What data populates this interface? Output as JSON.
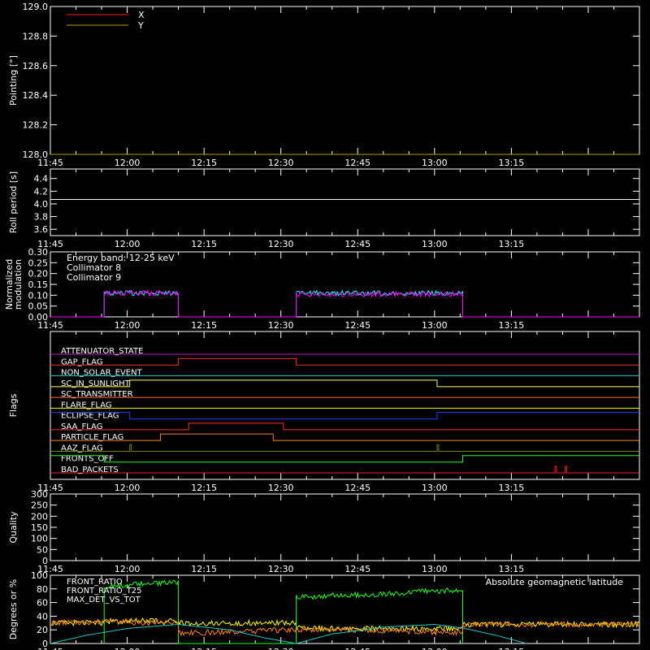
{
  "chart_data": [
    {
      "type": "line",
      "ylabel": "Pointing [°]",
      "ylim": [
        128.0,
        129.0
      ],
      "yticks": [
        "129.0",
        "128.8",
        "128.6",
        "128.4",
        "128.2",
        "128.0"
      ],
      "xlim": [
        -15,
        100
      ],
      "legend": "top-left",
      "series": [
        {
          "name": "X",
          "color": "#ff2020",
          "x": [
            -15,
            100
          ],
          "y": [
            128.0,
            128.0
          ]
        },
        {
          "name": "Y",
          "color": "#b4a000",
          "x": [
            -15,
            100
          ],
          "y": [
            128.0,
            128.0
          ]
        }
      ]
    },
    {
      "type": "line",
      "ylabel": "Roll period [s]",
      "ylim": [
        3.5,
        4.55
      ],
      "yticks": [
        "4.4",
        "4.2",
        "4.0",
        "3.8",
        "3.6"
      ],
      "xlim": [
        -15,
        100
      ],
      "series": [
        {
          "color": "#ffffff",
          "x": [
            -15,
            100
          ],
          "y": [
            4.07,
            4.07
          ]
        }
      ]
    },
    {
      "type": "line",
      "ylabel": "Normalized modulation",
      "ylim": [
        0.0,
        0.3
      ],
      "yticks": [
        "0.30",
        "0.25",
        "0.20",
        "0.15",
        "0.10",
        "0.05",
        "0.00"
      ],
      "xlim": [
        -15,
        100
      ],
      "annotation": "Energy band: 12-25 keV",
      "legend": "top-left",
      "series": [
        {
          "name": "Collimator 8",
          "color": "#00ffff",
          "x": [
            -15,
            -4.5,
            -4.5,
            10,
            10,
            33,
            33,
            65.5,
            65.5,
            100
          ],
          "y": [
            0,
            0,
            0.11,
            0.11,
            0,
            0,
            0.11,
            0.11,
            0,
            0
          ]
        },
        {
          "name": "Collimator 9",
          "color": "#ff00ff",
          "x": [
            -15,
            -4.5,
            -4.5,
            10,
            10,
            33,
            33,
            65.5,
            65.5,
            100
          ],
          "y": [
            0,
            0,
            0.11,
            0.11,
            0,
            0,
            0.105,
            0.105,
            0,
            0
          ]
        }
      ]
    },
    {
      "type": "line",
      "ylabel": "Flags",
      "xlim": [
        -15,
        100
      ],
      "flags": [
        {
          "name": "ATTENUATOR_STATE",
          "color": "#c020c0",
          "transitions": [],
          "start": 0
        },
        {
          "name": "GAP_FLAG",
          "color": "#ff3020",
          "transitions": [
            10,
            33
          ],
          "start": 0
        },
        {
          "name": "NON_SOLAR_EVENT",
          "color": "#00c8c8",
          "transitions": [],
          "start": 0
        },
        {
          "name": "SC_IN_SUNLIGHT",
          "color": "#ffff40",
          "transitions": [
            0.5,
            60.5
          ],
          "start": 0
        },
        {
          "name": "SC_TRANSMITTER",
          "color": "#ff7030",
          "transitions": [],
          "start": 0
        },
        {
          "name": "FLARE_FLAG",
          "color": "#ffff00",
          "transitions": [],
          "start": 0
        },
        {
          "name": "ECLIPSE_FLAG",
          "color": "#2040ff",
          "transitions": [
            0.5,
            60.5
          ],
          "start": 1
        },
        {
          "name": "SAA_FLAG",
          "color": "#ff3030",
          "transitions": [
            12,
            30.5
          ],
          "start": 0
        },
        {
          "name": "PARTICLE_FLAG",
          "color": "#ff8020",
          "transitions": [
            6.5,
            28.5
          ],
          "start": 0
        },
        {
          "name": "AAZ_FLAG",
          "color": "#808000",
          "pulses": [
            0.5,
            60.5
          ]
        },
        {
          "name": "FRONTS_OFF",
          "color": "#20ff20",
          "transitions": [
            -4.5,
            65.5
          ],
          "start": 1
        },
        {
          "name": "BAD_PACKETS",
          "color": "#ff2020",
          "pulses": [
            83.5,
            85.5
          ]
        }
      ]
    },
    {
      "type": "line",
      "ylabel": "Quality",
      "ylim": [
        0,
        300
      ],
      "yticks": [
        "300",
        "250",
        "200",
        "150",
        "100",
        "50",
        "0"
      ],
      "xlim": [
        -15,
        100
      ],
      "series": []
    },
    {
      "type": "line",
      "ylabel": "Degrees or %",
      "ylim": [
        0,
        100
      ],
      "yticks": [
        "100",
        "80",
        "60",
        "40",
        "20",
        "0"
      ],
      "xlim": [
        -15,
        100
      ],
      "legend": "top-left",
      "annotation": "Absolute geomagnetic latitude",
      "series": [
        {
          "name": "FRONT_RATIO",
          "color": "#ffff00",
          "x": [
            -15,
            -4.5,
            -4.5,
            10,
            10,
            33,
            33,
            65.5,
            65.5,
            100
          ],
          "y": [
            30,
            30,
            33,
            33,
            30,
            30,
            22,
            22,
            28,
            28
          ]
        },
        {
          "name": "FRONT_RATIO_T25",
          "color": "#20ff20",
          "x": [
            -4.5,
            -4.5,
            0,
            5,
            10,
            10,
            33,
            33,
            40,
            50,
            60,
            65.5,
            65.5
          ],
          "y": [
            0,
            82,
            86,
            88,
            90,
            0,
            0,
            67,
            70,
            73,
            77,
            78,
            0
          ]
        },
        {
          "name": "MAX_DET_VS_TOT",
          "color": "#ff8020",
          "x": [
            -15,
            -4.5,
            10,
            10,
            33,
            40,
            50,
            60,
            65.5,
            65.5,
            100
          ],
          "y": [
            30,
            32,
            30,
            15,
            20,
            21,
            18,
            17,
            16,
            28,
            28
          ]
        },
        {
          "name": "Absolute geomagnetic latitude",
          "color": "#20c8c8",
          "x": [
            -15,
            -8,
            0,
            10,
            20,
            27,
            33,
            40,
            50,
            60,
            66,
            72,
            78
          ],
          "y": [
            0,
            12,
            22,
            28,
            20,
            8,
            0,
            14,
            24,
            28,
            22,
            12,
            0
          ]
        }
      ]
    }
  ],
  "x_axis": {
    "tick_labels": [
      "11:45",
      "12:00",
      "12:15",
      "12:30",
      "12:45",
      "13:00",
      "13:15"
    ],
    "tick_values": [
      -15,
      0,
      15,
      30,
      45,
      60,
      75
    ]
  }
}
